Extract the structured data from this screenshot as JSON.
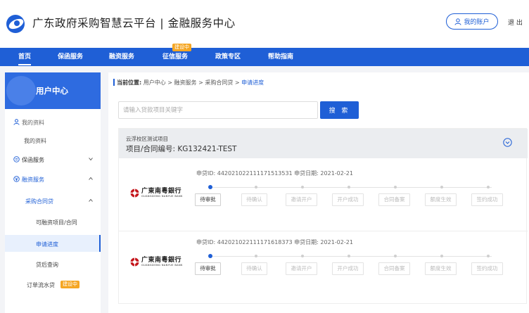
{
  "header": {
    "site_title": "广东政府采购智慧云平台 | 金融服务中心",
    "account_label": "我的账户",
    "logout_label": "退 出"
  },
  "nav": {
    "items": [
      {
        "label": "首页"
      },
      {
        "label": "保函服务"
      },
      {
        "label": "融资服务"
      },
      {
        "label": "征信服务",
        "badge": "建设中"
      },
      {
        "label": "政策专区"
      },
      {
        "label": "帮助指南"
      }
    ]
  },
  "sidebar": {
    "title": "用户中心",
    "my_profile_group": "我的资料",
    "my_profile": "我的资料",
    "guarantee": "保函服务",
    "financing": "融资服务",
    "purchase_loan": "采购合同贷",
    "financeable": "可融资项目/合同",
    "progress": "申请进度",
    "post_loan": "贷后查询",
    "order_flow": "订单流水贷",
    "order_badge": "建设中"
  },
  "main": {
    "crumb_label": "当前位置:",
    "crumb_path": "用户中心 > 融资服务 > 采购合同贷 > ",
    "crumb_current": "申请进度",
    "search_placeholder": "请输入贷款项目关键字",
    "search_button": "搜 索",
    "project": {
      "name": "云浮校区测试项目",
      "code": "项目/合同编号: KG132421-TEST"
    },
    "bank": {
      "name": "广東南粵銀行",
      "sub": "GUANGDONG NANYUE BANK"
    },
    "steps": [
      "待审批",
      "待确认",
      "邀请开户",
      "开户成功",
      "合同备案",
      "额度生效",
      "签约成功"
    ],
    "loans": [
      {
        "meta": "申贷ID: 442021022111171513531    申贷日期: 2021-02-21"
      },
      {
        "meta": "申贷ID: 442021022111171618373    申贷日期: 2021-02-21"
      }
    ]
  },
  "colors": {
    "primary": "#1f5fd6",
    "badge": "#f5a623"
  }
}
